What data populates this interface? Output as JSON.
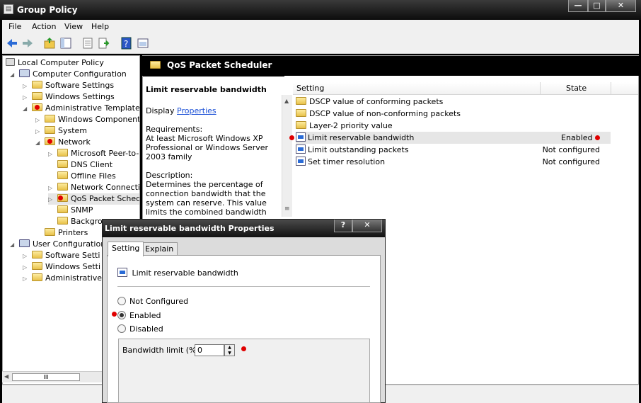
{
  "window": {
    "title": "Group Policy",
    "minimize": "—",
    "maximize": "□",
    "close": "✕"
  },
  "menu": [
    "File",
    "Action",
    "View",
    "Help"
  ],
  "tree": {
    "root": "Local Computer Policy",
    "computer_config": "Computer Configuration",
    "cc_software": "Software Settings",
    "cc_windows": "Windows Settings",
    "cc_admin": "Administrative Templates",
    "windows_components": "Windows Components",
    "system": "System",
    "network": "Network",
    "net_items": [
      "Microsoft Peer-to-P",
      "DNS Client",
      "Offline Files",
      "Network Connectio",
      "QoS Packet Schedu",
      "SNMP",
      "Backgro"
    ],
    "printers": "Printers",
    "user_config": "User Configuration",
    "uc_software": "Software Setti",
    "uc_windows": "Windows Setti",
    "uc_admin": "Administrative Templ",
    "hscroll_grip": "III"
  },
  "right": {
    "header_title": "QoS Packet Scheduler",
    "ext_title": "Limit reservable bandwidth",
    "display_label": "Display",
    "properties_link": "Properties",
    "requirements_label": "Requirements:",
    "requirements_text": "At least Microsoft Windows XP Professional or Windows Server 2003 family",
    "description_label": "Description:",
    "description_text": "Determines the percentage of connection bandwidth that the system can reserve. This value limits the combined bandwidth reservations",
    "col_setting": "Setting",
    "col_state": "State",
    "rows": [
      {
        "name": "DSCP value of conforming packets",
        "state": ""
      },
      {
        "name": "DSCP value of non-conforming packets",
        "state": ""
      },
      {
        "name": "Layer-2 priority value",
        "state": ""
      },
      {
        "name": "Limit reservable bandwidth",
        "state": "Enabled"
      },
      {
        "name": "Limit outstanding packets",
        "state": "Not configured"
      },
      {
        "name": "Set timer resolution",
        "state": "Not configured"
      }
    ]
  },
  "dialog": {
    "title": "Limit reservable bandwidth Properties",
    "help_btn": "?",
    "close_btn": "✕",
    "tab_setting": "Setting",
    "tab_explain": "Explain",
    "policy_name": "Limit reservable bandwidth",
    "opt_not_configured": "Not Configured",
    "opt_enabled": "Enabled",
    "opt_disabled": "Disabled",
    "bandwidth_label": "Bandwidth limit (%):",
    "bandwidth_value": "0"
  }
}
